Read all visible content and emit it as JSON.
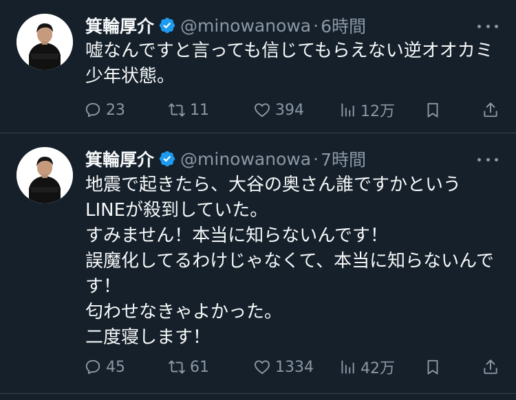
{
  "colors": {
    "background": "#15202b",
    "text": "#f7f9f9",
    "muted": "#8b98a5",
    "verified": "#1d9bf0",
    "divider": "#38444d"
  },
  "tweets": [
    {
      "author": "箕輪厚介",
      "handle": "@minowanowa",
      "separator": "·",
      "time": "6時間",
      "lines": [
        "嘘なんですと言っても信じてもらえない逆オオカミ",
        "少年状態。"
      ],
      "replies": "23",
      "retweets": "11",
      "likes": "394",
      "views": "12万"
    },
    {
      "author": "箕輪厚介",
      "handle": "@minowanowa",
      "separator": "·",
      "time": "7時間",
      "lines": [
        "地震で起きたら、大谷の奥さん誰ですかという",
        "LINEが殺到していた。",
        "すみません！本当に知らないんです！",
        "誤魔化してるわけじゃなくて、本当に知らないんで",
        "す！",
        "匂わせなきゃよかった。",
        "二度寝します！"
      ],
      "replies": "45",
      "retweets": "61",
      "likes": "1334",
      "views": "42万"
    }
  ]
}
